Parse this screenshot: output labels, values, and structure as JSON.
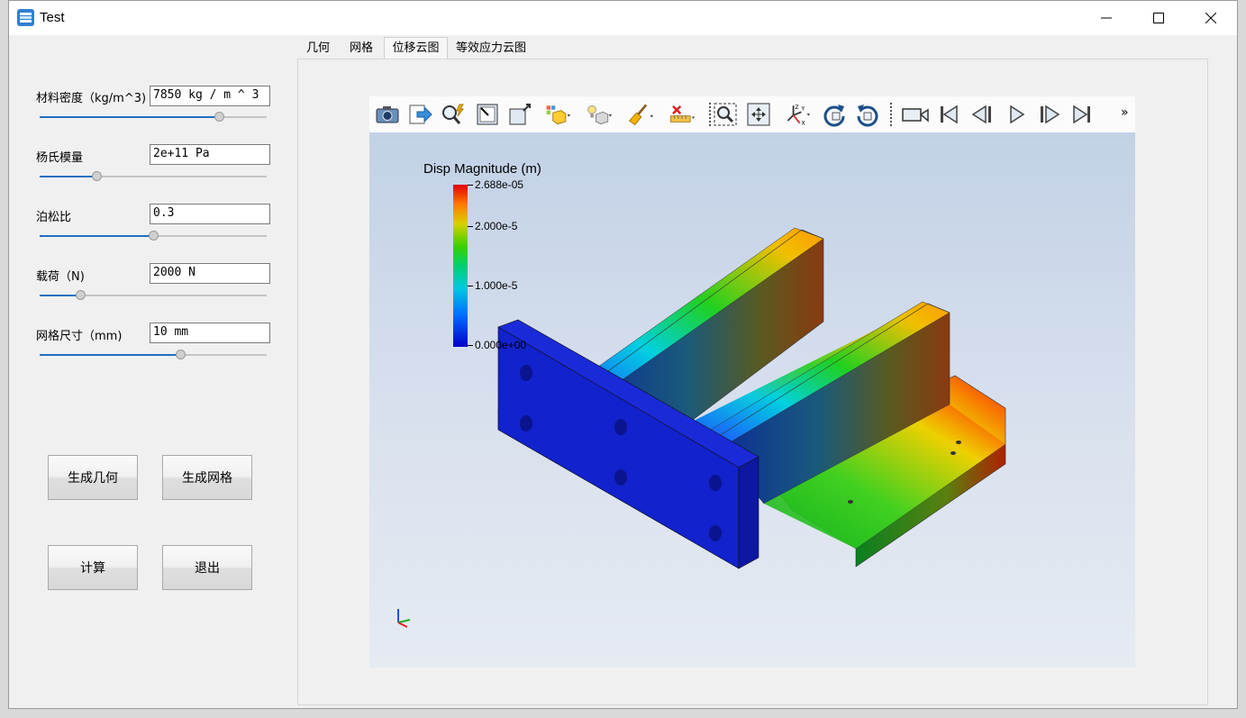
{
  "window": {
    "title": "Test"
  },
  "params": [
    {
      "label": "材料密度（kg/m^3)",
      "value": "7850 kg / m ^ 3",
      "slider": 0.79
    },
    {
      "label": "杨氏模量",
      "value": "2e+11 Pa",
      "slider": 0.25
    },
    {
      "label": "泊松比",
      "value": "0.3",
      "slider": 0.5
    },
    {
      "label": "载荷（N)",
      "value": "2000 N",
      "slider": 0.18
    },
    {
      "label": "网格尺寸（mm)",
      "value": "10 mm",
      "slider": 0.62
    }
  ],
  "buttons": {
    "gen_geometry": "生成几何",
    "gen_mesh": "生成网格",
    "compute": "计算",
    "exit": "退出"
  },
  "tabs": [
    "几何",
    "网格",
    "位移云图",
    "等效应力云图"
  ],
  "active_tab": "位移云图",
  "viewer": {
    "legend_title": "Disp Magnitude (m)",
    "colorbar_labels": [
      "2.688e-05",
      "2.000e-5",
      "1.000e-5",
      "0.000e+00"
    ],
    "toolbar_more": "»"
  },
  "toolbar_icons": [
    "camera-icon",
    "export-icon",
    "zoom-pick-icon",
    "reset-camera-icon",
    "view-box-icon",
    "representation-icon",
    "light-icon",
    "clear-brush-icon",
    "ruler-delete-icon",
    "zoom-box-icon",
    "fit-view-icon",
    "axes-orient-icon",
    "rotate-cw-icon",
    "rotate-ccw-icon",
    "video-camera-icon",
    "first-frame-icon",
    "prev-frame-icon",
    "play-icon",
    "next-frame-icon",
    "last-frame-icon"
  ]
}
